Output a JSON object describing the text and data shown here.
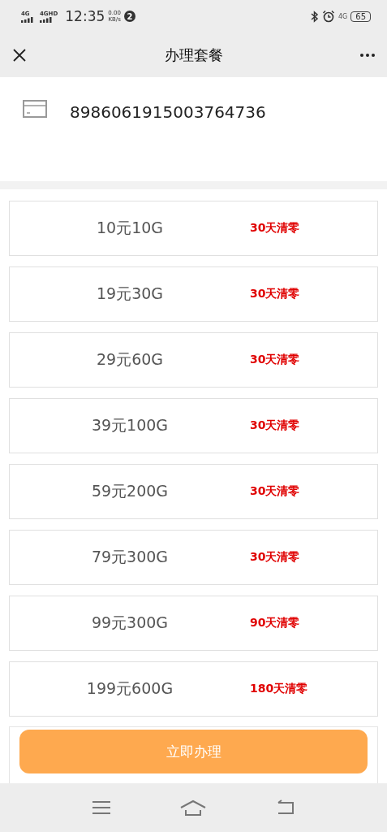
{
  "status_bar": {
    "signal_1": "4G",
    "signal_2": "4GHD",
    "time": "12:35",
    "speed_value": "0.00",
    "speed_unit": "KB/s",
    "notification_count": "2",
    "network": "4G",
    "battery": "65"
  },
  "header": {
    "title": "办理套餐"
  },
  "card": {
    "number": "8986061915003764736"
  },
  "plans": [
    {
      "name": "10元10G",
      "period": "30天清零"
    },
    {
      "name": "19元30G",
      "period": "30天清零"
    },
    {
      "name": "29元60G",
      "period": "30天清零"
    },
    {
      "name": "39元100G",
      "period": "30天清零"
    },
    {
      "name": "59元200G",
      "period": "30天清零"
    },
    {
      "name": "79元300G",
      "period": "30天清零"
    },
    {
      "name": "99元300G",
      "period": "90天清零"
    },
    {
      "name": "199元600G",
      "period": "180天清零"
    }
  ],
  "submit_button": "立即办理"
}
